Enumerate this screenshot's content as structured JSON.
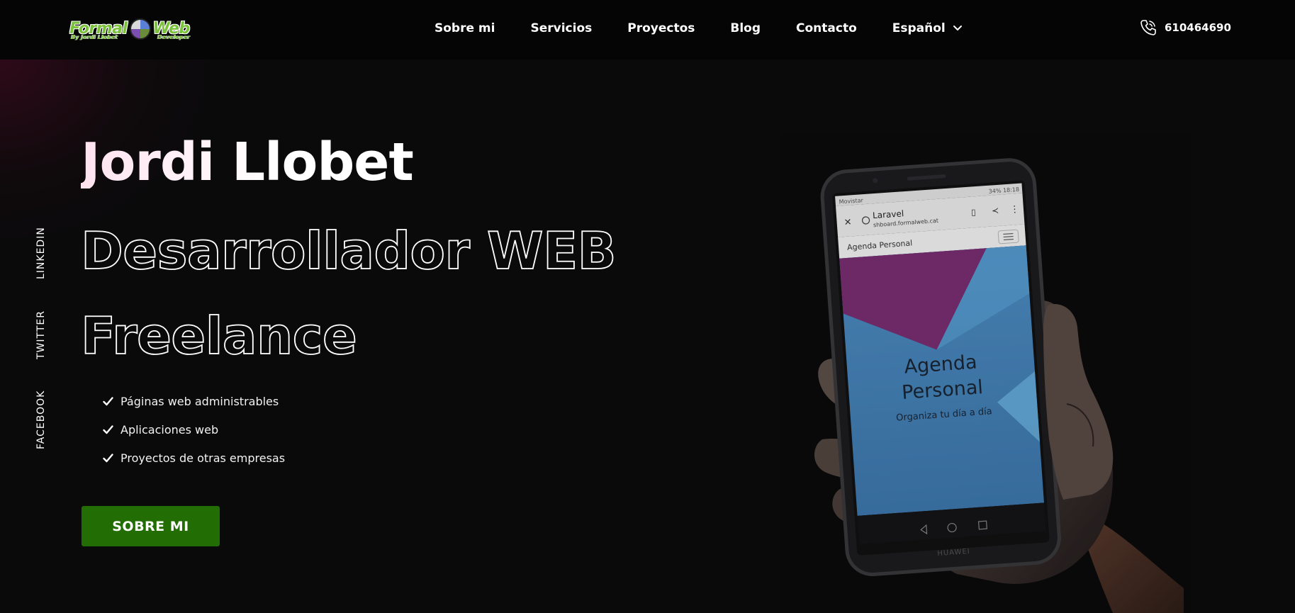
{
  "header": {
    "logo": {
      "word_left": "Formal",
      "word_right": "Web",
      "sub_left": "By Jordi Llobet",
      "sub_right": "Developer"
    },
    "nav": [
      {
        "label": "Sobre mi"
      },
      {
        "label": "Servicios"
      },
      {
        "label": "Proyectos"
      },
      {
        "label": "Blog"
      },
      {
        "label": "Contacto"
      },
      {
        "label": "Español"
      }
    ],
    "phone": "610464690"
  },
  "social": [
    "LINKEDIN",
    "TWITTER",
    "FACEBOOK"
  ],
  "hero": {
    "name": "Jordi Llobet",
    "role": "Desarrollador WEB",
    "type": "Freelance",
    "features": [
      "Páginas web administrables",
      "Aplicaciones web",
      "Proyectos de otras empresas"
    ],
    "cta": "SOBRE MI"
  },
  "phone_screen": {
    "carrier": "Movistar",
    "status": "34% 18:18",
    "browser_title": "Laravel",
    "browser_url": "shboard.formalweb.cat",
    "app_bar": "Agenda Personal",
    "hero_line1": "Agenda",
    "hero_line2": "Personal",
    "tagline": "Organiza tu día a día",
    "brand": "HUAWEI"
  },
  "colors": {
    "background": "#0a0a0b",
    "header": "#050506",
    "accent_green": "#236e04",
    "logo_green": "#79c23a"
  }
}
